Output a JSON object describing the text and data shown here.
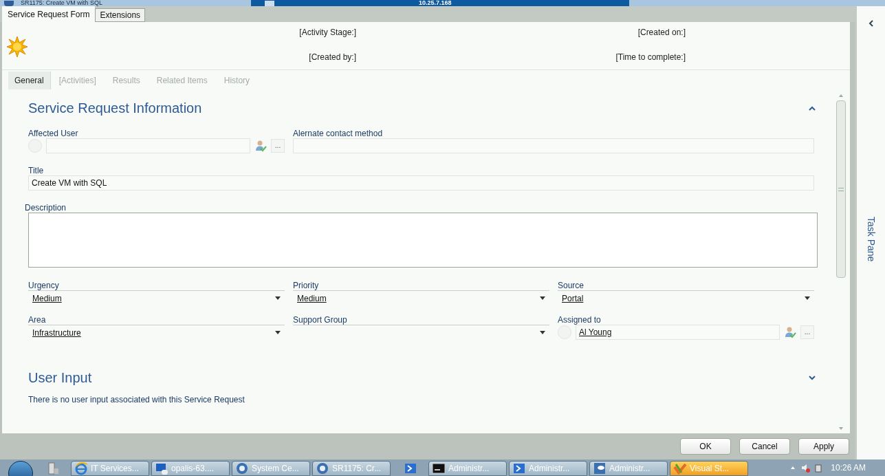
{
  "window": {
    "title": "SR1175: Create VM with SQL"
  },
  "remote_bar": {
    "address": "10.25.7.168"
  },
  "form_tabs": [
    {
      "label": "Service Request Form",
      "selected": true
    },
    {
      "label": "Extensions",
      "selected": false
    }
  ],
  "header": {
    "left": [
      "[Activity Stage:]",
      "[Created by:]"
    ],
    "right": [
      "[Created on:]",
      "[Time to complete:]"
    ]
  },
  "tabs": [
    {
      "label": "General",
      "selected": true
    },
    {
      "label": "[Activities]",
      "selected": false
    },
    {
      "label": "Results",
      "selected": false
    },
    {
      "label": "Related Items",
      "selected": false
    },
    {
      "label": "History",
      "selected": false
    }
  ],
  "sections": [
    {
      "title": "Service Request Information",
      "expanded": true,
      "rows": [
        [
          {
            "label": "Affected User",
            "kind": "user",
            "browse": "..."
          },
          {
            "label": "Alernate contact method",
            "kind": "text"
          }
        ],
        [
          {
            "label": "Title",
            "kind": "text",
            "value": "Create VM with SQL"
          }
        ],
        [
          {
            "label": "Description",
            "kind": "textarea"
          }
        ],
        [
          {
            "label": "Urgency",
            "kind": "dropdown",
            "value": "Medium"
          },
          {
            "label": "Priority",
            "kind": "dropdown",
            "value": "Medium"
          },
          {
            "label": "Source",
            "kind": "dropdown",
            "value": "Portal"
          }
        ],
        [
          {
            "label": "Area",
            "kind": "dropdown",
            "value": "Infrastructure"
          },
          {
            "label": "Support Group",
            "kind": "dropdown"
          },
          {
            "label": "Assigned to",
            "kind": "user",
            "value": "Al Young",
            "browse": "..."
          }
        ]
      ]
    },
    {
      "title": "User Input",
      "expanded": false,
      "message": "There is no user input associated with this Service Request"
    }
  ],
  "task_pane": {
    "label": "Task Pane"
  },
  "buttons": [
    "OK",
    "Cancel",
    "Apply"
  ],
  "taskbar": {
    "items": [
      {
        "kind": "server"
      },
      {
        "kind": "browser",
        "label": "IT Services...",
        "highlighted": false
      },
      {
        "kind": "monitor",
        "label": "opalis-63....",
        "highlighted": false
      },
      {
        "kind": "console",
        "label": "System Ce...",
        "highlighted": false
      },
      {
        "kind": "console",
        "label": "SR1175: Cr...",
        "highlighted": false
      },
      {
        "kind": "shell"
      },
      {
        "kind": "terminal",
        "label": "Administr...",
        "highlighted": false
      },
      {
        "kind": "shell",
        "label": "Administr...",
        "highlighted": false
      },
      {
        "kind": "cloud",
        "label": "Administr...",
        "highlighted": false
      },
      {
        "kind": "studio",
        "label": "Visual St...",
        "highlighted": true
      }
    ],
    "clock": "10:26 AM"
  }
}
